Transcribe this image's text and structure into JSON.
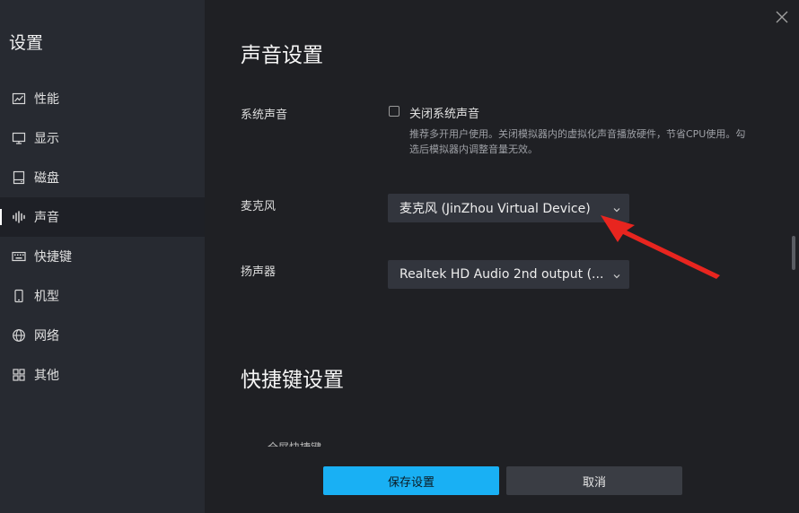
{
  "sidebar": {
    "title": "设置",
    "items": [
      {
        "label": "性能",
        "icon": "performance-chart-icon"
      },
      {
        "label": "显示",
        "icon": "monitor-icon"
      },
      {
        "label": "磁盘",
        "icon": "disk-icon"
      },
      {
        "label": "声音",
        "icon": "sound-wave-icon"
      },
      {
        "label": "快捷键",
        "icon": "keyboard-icon"
      },
      {
        "label": "机型",
        "icon": "phone-icon"
      },
      {
        "label": "网络",
        "icon": "globe-icon"
      },
      {
        "label": "其他",
        "icon": "grid-icon"
      }
    ],
    "active_item": "声音"
  },
  "main": {
    "section_title": "声音设置",
    "system_sound": {
      "label": "系统声音",
      "checkbox_label": "关闭系统声音",
      "checked": false,
      "hint": "推荐多开用户使用。关闭模拟器内的虚拟化声音播放硬件，节省CPU使用。勾选后模拟器内调整音量无效。"
    },
    "microphone": {
      "label": "麦克风",
      "value": "麦克风 (JinZhou Virtual Device)"
    },
    "speaker": {
      "label": "扬声器",
      "value": "Realtek HD Audio 2nd output (..."
    },
    "shortcut_section_title": "快捷键设置",
    "partial_text": "全屏快捷键"
  },
  "footer": {
    "save_label": "保存设置",
    "cancel_label": "取消"
  },
  "colors": {
    "accent": "#19b0f4",
    "annotation_arrow": "#e8251f",
    "sidebar_bg": "#272a31",
    "main_bg": "#1f2024"
  }
}
